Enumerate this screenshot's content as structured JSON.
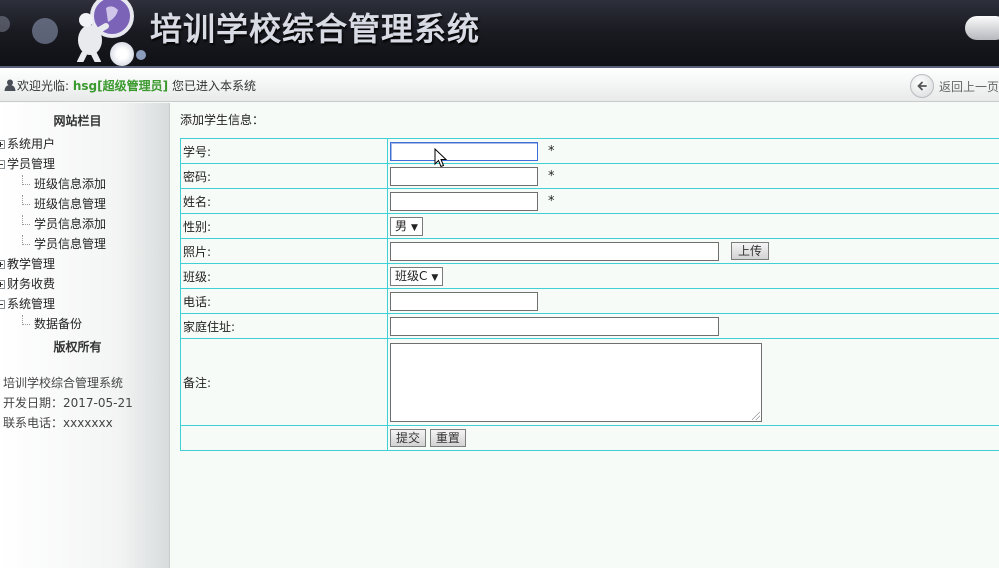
{
  "header": {
    "title": "培训学校综合管理系统"
  },
  "statusbar": {
    "welcome_prefix": "欢迎光临:",
    "user": "hsg[超级管理员]",
    "welcome_suffix": "您已进入本系统",
    "back_label": "返回上一页"
  },
  "sidebar": {
    "heading": "网站栏目",
    "tree": [
      {
        "label": "系统用户",
        "expanded": false
      },
      {
        "label": "学员管理",
        "expanded": true,
        "children": [
          "班级信息添加",
          "班级信息管理",
          "学员信息添加",
          "学员信息管理"
        ]
      },
      {
        "label": "教学管理",
        "expanded": false
      },
      {
        "label": "财务收费",
        "expanded": false
      },
      {
        "label": "系统管理",
        "expanded": true,
        "children": [
          "数据备份"
        ]
      }
    ],
    "copyright_heading": "版权所有",
    "info": [
      "培训学校综合管理系统",
      "开发日期：2017-05-21",
      "联系电话：xxxxxxx"
    ]
  },
  "form": {
    "title": "添加学生信息：",
    "fields": {
      "student_id": {
        "label": "学号:",
        "value": "",
        "required": "*"
      },
      "password": {
        "label": "密码:",
        "value": "",
        "required": "*"
      },
      "name": {
        "label": "姓名:",
        "value": "",
        "required": "*"
      },
      "gender": {
        "label": "性别:",
        "selected": "男"
      },
      "photo": {
        "label": "照片:",
        "value": "",
        "upload_label": "上传"
      },
      "class": {
        "label": "班级:",
        "selected": "班级C"
      },
      "phone": {
        "label": "电话:",
        "value": ""
      },
      "address": {
        "label": "家庭住址:",
        "value": ""
      },
      "notes": {
        "label": "备注:",
        "value": ""
      }
    },
    "submit_label": "提交",
    "reset_label": "重置"
  },
  "colors": {
    "user_highlight": "#3a9a2e",
    "table_border": "#3fd0d6",
    "focus_border": "#3d6fd8"
  }
}
